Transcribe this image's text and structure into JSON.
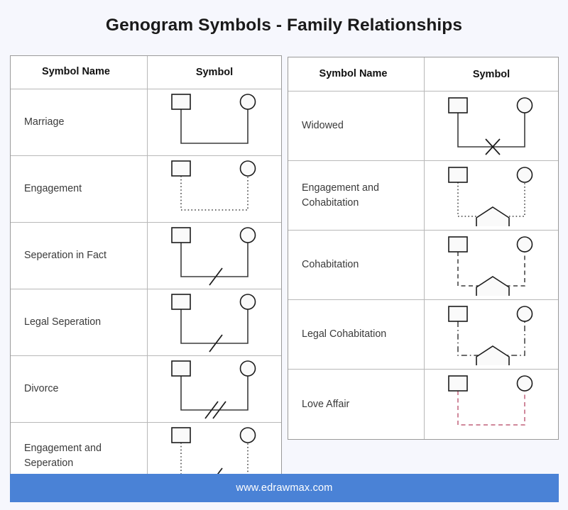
{
  "page": {
    "title": "Genogram Symbols - Family Relationships",
    "background_color": "#f6f7fd"
  },
  "footer": {
    "text": "www.edrawmax.com",
    "background_color": "#4a82d6",
    "text_color": "#ffffff"
  },
  "colors": {
    "line": "#3b3b3b",
    "love_affair_line": "#c0607a",
    "table_border": "#9a9a9a",
    "row_border": "#b8b8b8",
    "shape_fill": "#fafafa",
    "shape_stroke": "#1b1b1b"
  },
  "tables": [
    {
      "id": "left",
      "headers": {
        "name": "Symbol Name",
        "symbol": "Symbol"
      },
      "rows": [
        {
          "name": "Marriage",
          "symbol": {
            "icon": "marriage-symbol",
            "line_style": "solid",
            "line_color": "#3b3b3b",
            "left_shape": "square",
            "right_shape": "circle",
            "marker": "none",
            "center_shape": "none"
          }
        },
        {
          "name": "Engagement",
          "symbol": {
            "icon": "engagement-symbol",
            "line_style": "dotted",
            "line_color": "#3b3b3b",
            "left_shape": "square",
            "right_shape": "circle",
            "marker": "none",
            "center_shape": "none"
          }
        },
        {
          "name": "Seperation in Fact",
          "symbol": {
            "icon": "separation-in-fact-symbol",
            "line_style": "solid",
            "line_color": "#3b3b3b",
            "left_shape": "square",
            "right_shape": "circle",
            "marker": "single-slash",
            "center_shape": "none"
          }
        },
        {
          "name": "Legal Seperation",
          "symbol": {
            "icon": "legal-separation-symbol",
            "line_style": "solid",
            "line_color": "#3b3b3b",
            "left_shape": "square",
            "right_shape": "circle",
            "marker": "single-slash",
            "center_shape": "none"
          }
        },
        {
          "name": "Divorce",
          "symbol": {
            "icon": "divorce-symbol",
            "line_style": "solid",
            "line_color": "#3b3b3b",
            "left_shape": "square",
            "right_shape": "circle",
            "marker": "double-slash",
            "center_shape": "none"
          }
        },
        {
          "name": "Engagement and Seperation",
          "symbol": {
            "icon": "engagement-and-separation-symbol",
            "line_style": "dotted",
            "line_color": "#3b3b3b",
            "left_shape": "square",
            "right_shape": "circle",
            "marker": "single-slash",
            "center_shape": "none"
          }
        }
      ]
    },
    {
      "id": "right",
      "headers": {
        "name": "Symbol Name",
        "symbol": "Symbol"
      },
      "rows": [
        {
          "name": "Widowed",
          "symbol": {
            "icon": "widowed-symbol",
            "line_style": "solid",
            "line_color": "#3b3b3b",
            "left_shape": "square",
            "right_shape": "circle",
            "marker": "cross",
            "center_shape": "none"
          }
        },
        {
          "name": "Engagement and Cohabitation",
          "symbol": {
            "icon": "engagement-and-cohabitation-symbol",
            "line_style": "dotted",
            "line_color": "#3b3b3b",
            "left_shape": "square",
            "right_shape": "circle",
            "marker": "none",
            "center_shape": "house"
          }
        },
        {
          "name": "Cohabitation",
          "symbol": {
            "icon": "cohabitation-symbol",
            "line_style": "dashed",
            "line_color": "#3b3b3b",
            "left_shape": "square",
            "right_shape": "circle",
            "marker": "none",
            "center_shape": "house"
          }
        },
        {
          "name": "Legal Cohabitation",
          "symbol": {
            "icon": "legal-cohabitation-symbol",
            "line_style": "dash-dot",
            "line_color": "#3b3b3b",
            "left_shape": "square",
            "right_shape": "circle",
            "marker": "none",
            "center_shape": "house"
          }
        },
        {
          "name": "Love Affair",
          "symbol": {
            "icon": "love-affair-symbol",
            "line_style": "dashed",
            "line_color": "#c0607a",
            "left_shape": "square",
            "right_shape": "circle",
            "marker": "none",
            "center_shape": "none"
          }
        }
      ]
    }
  ]
}
